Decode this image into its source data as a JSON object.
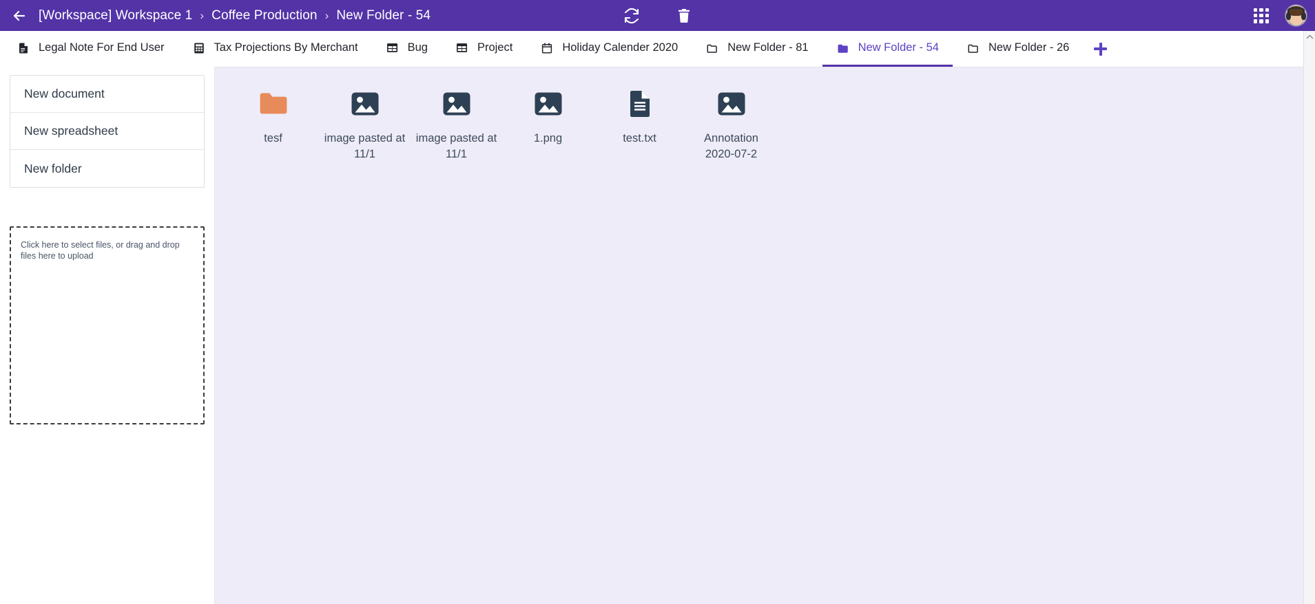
{
  "header": {
    "back_icon": "arrow-left-icon",
    "breadcrumb": {
      "items": [
        "[Workspace] Workspace 1",
        "Coffee Production",
        "New Folder - 54"
      ],
      "separator": "›"
    },
    "actions": [
      {
        "name": "refresh",
        "icon": "refresh-icon"
      },
      {
        "name": "trash",
        "icon": "trash-icon"
      }
    ],
    "apps_icon": "apps-grid-icon",
    "avatar_name": "user-avatar",
    "bg_color": "#5333a6"
  },
  "tabs": {
    "items": [
      {
        "label": "Legal Note For End User",
        "icon": "document-icon",
        "active": false
      },
      {
        "label": "Tax Projections By Merchant",
        "icon": "spreadsheet-icon",
        "active": false
      },
      {
        "label": "Bug",
        "icon": "table-icon",
        "active": false
      },
      {
        "label": "Project",
        "icon": "table-icon",
        "active": false
      },
      {
        "label": "Holiday Calender 2020",
        "icon": "calendar-icon",
        "active": false
      },
      {
        "label": "New Folder - 81",
        "icon": "folder-outline-icon",
        "active": false
      },
      {
        "label": "New Folder - 54",
        "icon": "folder-outline-icon",
        "active": true
      },
      {
        "label": "New Folder - 26",
        "icon": "folder-outline-icon",
        "active": false
      }
    ],
    "add_tab_icon": "plus-icon",
    "active_color": "#5d42c4",
    "indicator_color": "#5232a8"
  },
  "sidebar": {
    "menu": [
      {
        "label": "New document",
        "name": "new-document"
      },
      {
        "label": "New spreadsheet",
        "name": "new-spreadsheet"
      },
      {
        "label": "New folder",
        "name": "new-folder"
      }
    ],
    "dropzone": {
      "text": "Click here to select files, or drag and drop files here to upload"
    }
  },
  "main": {
    "bg_color": "#eeecf8",
    "files": [
      {
        "name": "tesf",
        "icon": "folder-icon",
        "color": "#e88b5a"
      },
      {
        "name": "image pasted at 11/1",
        "icon": "image-icon",
        "color": "#2e4054"
      },
      {
        "name": "image pasted at 11/1",
        "icon": "image-icon",
        "color": "#2e4054"
      },
      {
        "name": "1.png",
        "icon": "image-icon",
        "color": "#2e4054"
      },
      {
        "name": "test.txt",
        "icon": "text-file-icon",
        "color": "#2e4054"
      },
      {
        "name": "Annotation 2020-07-2",
        "icon": "image-icon",
        "color": "#2e4054"
      }
    ]
  },
  "scrollbar": {
    "up_arrow_icon": "chevron-up-icon"
  }
}
